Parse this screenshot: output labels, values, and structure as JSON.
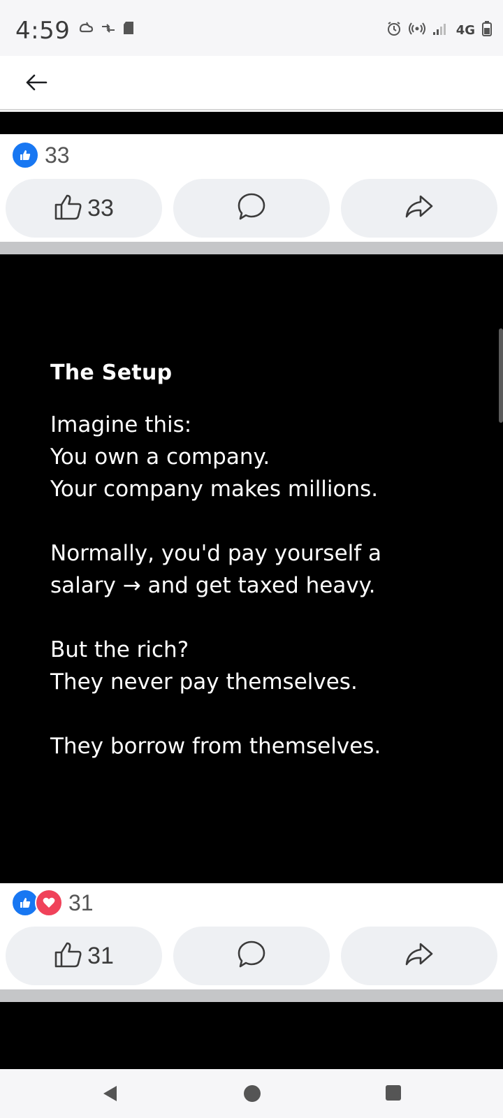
{
  "status_bar": {
    "time": "4:59",
    "network": "4G",
    "icons_left": [
      "weather-icon",
      "data-transfer-icon",
      "sd-card-icon"
    ],
    "icons_right": [
      "alarm-icon",
      "hotspot-icon",
      "signal-icon",
      "battery-icon"
    ]
  },
  "header": {
    "back_icon": "back-arrow-icon"
  },
  "posts": [
    {
      "reaction_count": "33",
      "like_count": "33",
      "reactions": [
        "like"
      ]
    },
    {
      "reaction_count": "31",
      "like_count": "31",
      "reactions": [
        "like",
        "love"
      ]
    }
  ],
  "post_image": {
    "heading": "The Setup",
    "lines": [
      "Imagine this:",
      "You own a company.",
      "Your company makes millions.",
      "",
      "Normally, you'd pay yourself a",
      "salary → and get taxed heavy.",
      "",
      "But the rich?",
      "They never pay themselves.",
      "",
      "They borrow from themselves."
    ]
  },
  "actions": [
    "like-button",
    "comment-button",
    "share-button"
  ],
  "colors": {
    "accent": "#1877f2",
    "love": "#f0425a",
    "pill_bg": "#eef0f3",
    "media_bg": "#000000"
  },
  "nav": [
    "back-nav-icon",
    "home-nav-icon",
    "recents-nav-icon"
  ]
}
